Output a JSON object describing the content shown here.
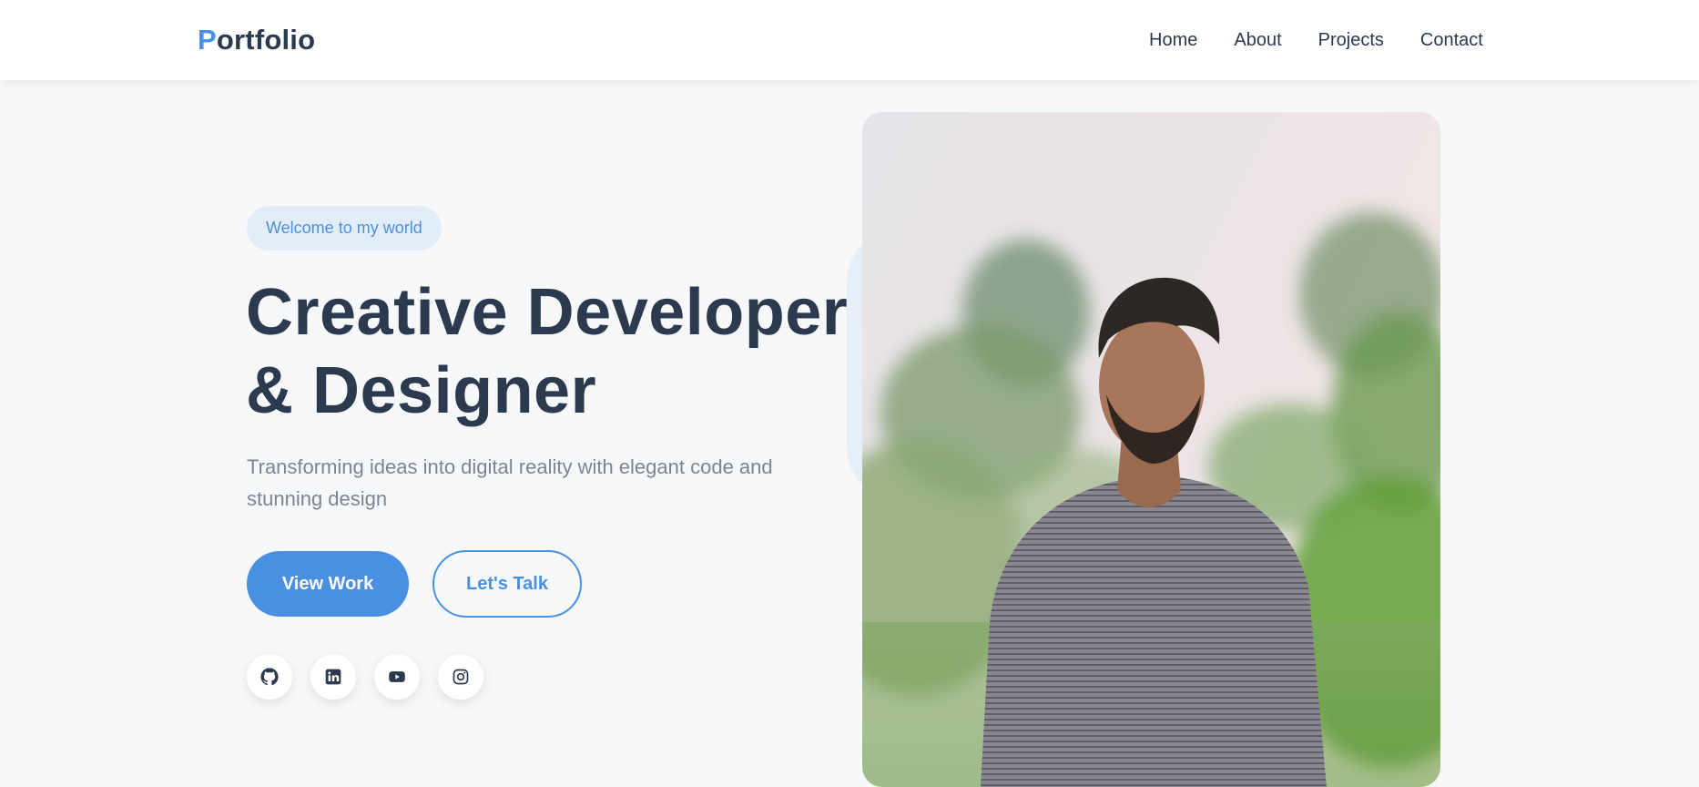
{
  "header": {
    "logo_initial": "P",
    "logo_rest": "ortfolio",
    "nav": [
      "Home",
      "About",
      "Projects",
      "Contact"
    ]
  },
  "hero": {
    "badge": "Welcome to my world",
    "title_line1": "Creative Developer",
    "title_line2": "& Designer",
    "subtitle": "Transforming ideas into digital reality with elegant code and stunning design",
    "primary_button": "View Work",
    "secondary_button": "Let's Talk",
    "socials": [
      "github-icon",
      "linkedin-icon",
      "youtube-icon",
      "instagram-icon"
    ]
  },
  "colors": {
    "accent": "#4a90e2",
    "text": "#2b3a4e",
    "muted": "#7b8593",
    "background": "#f7f8fa"
  }
}
